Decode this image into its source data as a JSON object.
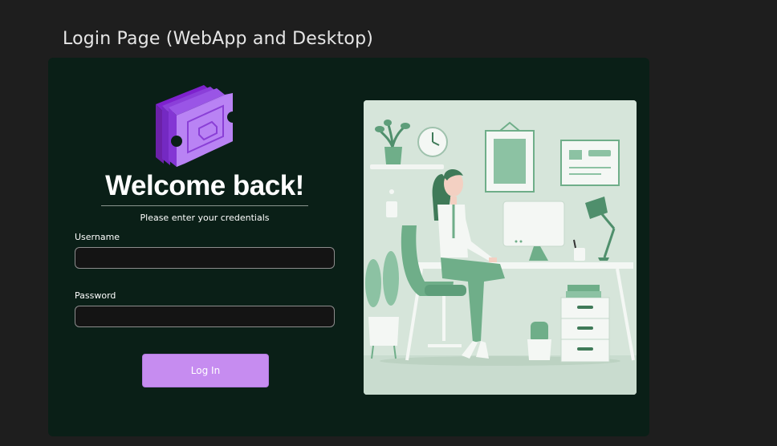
{
  "frame": {
    "title": "Login Page (WebApp and Desktop)"
  },
  "login": {
    "heading": "Welcome back!",
    "subtitle": "Please enter your credentials",
    "username_label": "Username",
    "username_value": "",
    "password_label": "Password",
    "password_value": "",
    "button_label": "Log In"
  },
  "colors": {
    "page_bg": "#1e1e1e",
    "card_bg": "#0a1f17",
    "accent": "#c68cf0",
    "logo_purple": "#a855f7",
    "illustration_bg": "#d6e5da",
    "illustration_green": "#6fae89"
  },
  "icons": {
    "logo": "stacked-tickets-logo",
    "illustration": "woman-working-at-desk-illustration"
  }
}
